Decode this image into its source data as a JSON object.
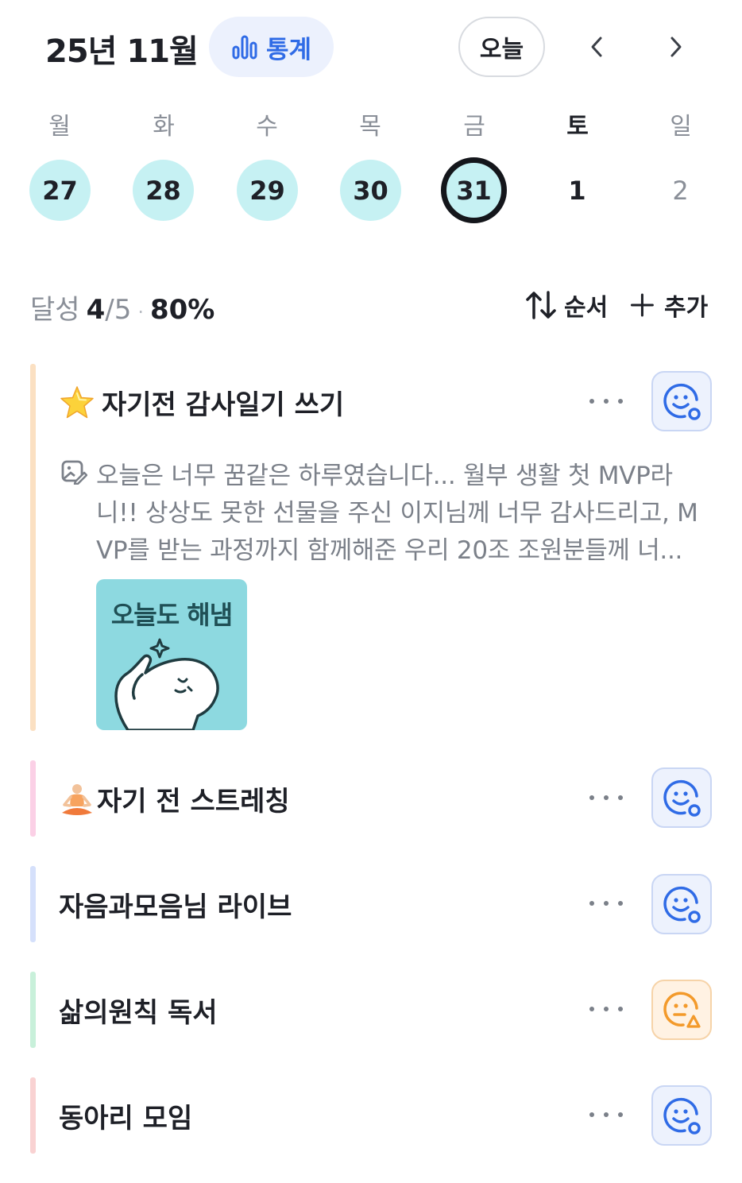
{
  "header": {
    "title": "25년 11월",
    "stats_label": "통계",
    "today_label": "오늘",
    "prev_icon": "chevron-left-icon",
    "next_icon": "chevron-right-icon"
  },
  "week": {
    "days": [
      {
        "weekday": "월",
        "date": "27",
        "state": "done"
      },
      {
        "weekday": "화",
        "date": "28",
        "state": "done"
      },
      {
        "weekday": "수",
        "date": "29",
        "state": "done"
      },
      {
        "weekday": "목",
        "date": "30",
        "state": "done"
      },
      {
        "weekday": "금",
        "date": "31",
        "state": "selected"
      },
      {
        "weekday": "토",
        "date": "1",
        "state": "plain"
      },
      {
        "weekday": "일",
        "date": "2",
        "state": "plain"
      }
    ]
  },
  "summary": {
    "label": "달성",
    "done": "4",
    "slash_total": "/5",
    "separator": "·",
    "percent": "80%",
    "sort_label": "순서",
    "add_label": "추가"
  },
  "habits": [
    {
      "title": "자기전 감사일기 쓰기",
      "emoji": "star-emoji",
      "mood": "happy",
      "memo": {
        "lines": [
          "오늘은 너무 꿈같은 하루였습니다... 월부 생활 첫 MVP라",
          "니!! 상상도 못한 선물을 주신 이지님께 너무 감사드리고, M",
          "VP를 받는 과정까지 함께해준 우리 20조 조원분들께 너..."
        ],
        "sticker_text": "오늘도 해냄"
      },
      "color": "#fbe0c2"
    },
    {
      "title": "자기 전 스트레칭",
      "emoji": "meditation-emoji",
      "mood": "happy",
      "color": "#fbd0e6"
    },
    {
      "title": "자음과모음님 라이브",
      "emoji": "",
      "mood": "happy",
      "color": "#d5e0fb"
    },
    {
      "title": "삶의원칙 독서",
      "emoji": "",
      "mood": "meh",
      "color": "#c8f0da"
    },
    {
      "title": "동아리 모임",
      "emoji": "",
      "mood": "happy",
      "color": "#f9d2d2"
    }
  ],
  "colors": {
    "accent": "#2f6be6",
    "done_day": "#c6f1f3",
    "warn": "#f39a2b",
    "sticker_bg": "#8dd9e0"
  }
}
